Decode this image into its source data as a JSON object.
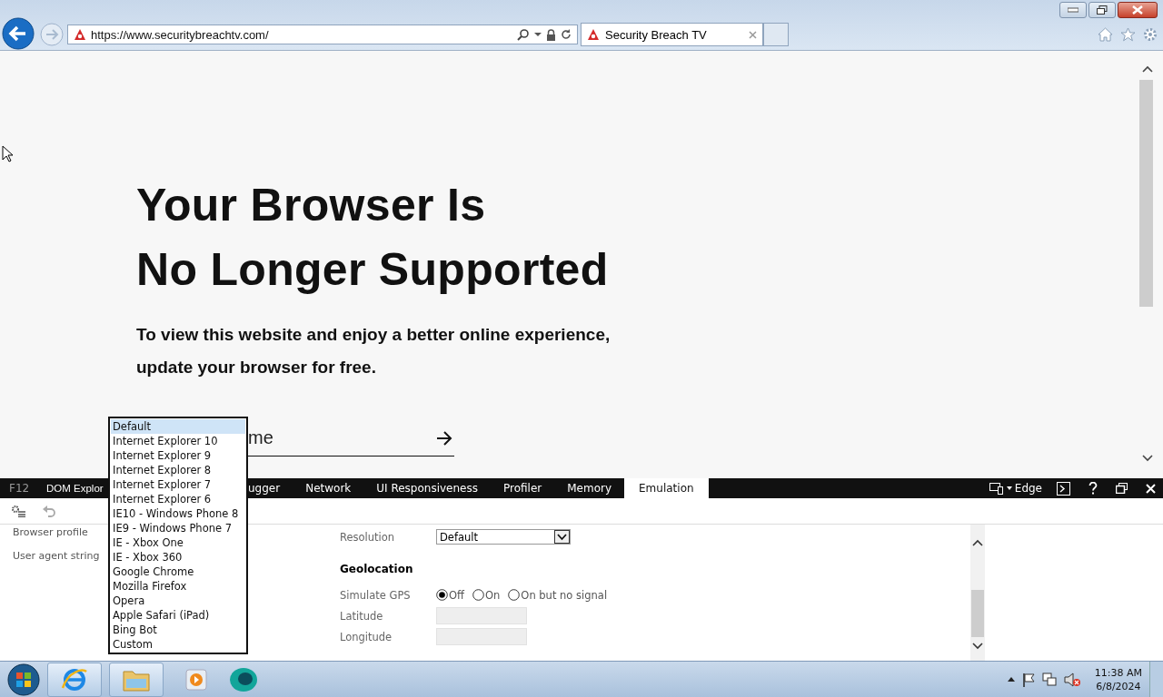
{
  "browser": {
    "back_enabled": true,
    "forward_enabled": false,
    "address": "https://www.securitybreachtv.com/",
    "tabs": [
      {
        "title": "Security Breach TV",
        "selected": true
      }
    ]
  },
  "page": {
    "heading_lines": [
      "Your Browser Is",
      "No Longer Supported"
    ],
    "subtext_lines": [
      "To view this website and enjoy a better online experience,",
      "update your browser for free."
    ],
    "input_visible_text": "me"
  },
  "devtools": {
    "f12_label": "F12",
    "tabs": [
      {
        "label": "DOM Explor",
        "selected": false
      },
      {
        "label": "ugger",
        "selected": false
      },
      {
        "label": "Network",
        "selected": false
      },
      {
        "label": "UI Responsiveness",
        "selected": false
      },
      {
        "label": "Profiler",
        "selected": false
      },
      {
        "label": "Memory",
        "selected": false
      },
      {
        "label": "Emulation",
        "selected": true
      }
    ],
    "mode": "Edge",
    "left_labels": [
      "Browser profile",
      "User agent string"
    ],
    "resolution": {
      "label": "Resolution",
      "value": "Default"
    },
    "geolocation": {
      "heading": "Geolocation",
      "gps_label": "Simulate GPS",
      "gps_options": [
        {
          "label": "Off",
          "selected": true
        },
        {
          "label": "On",
          "selected": false
        },
        {
          "label": "On but no signal",
          "selected": false
        }
      ],
      "fields": [
        {
          "label": "Latitude"
        },
        {
          "label": "Longitude"
        }
      ]
    },
    "dropdown": {
      "options": [
        {
          "label": "Default",
          "selected": true
        },
        {
          "label": "Internet Explorer 10",
          "selected": false
        },
        {
          "label": "Internet Explorer 9",
          "selected": false
        },
        {
          "label": "Internet Explorer 8",
          "selected": false
        },
        {
          "label": "Internet Explorer 7",
          "selected": false
        },
        {
          "label": "Internet Explorer 6",
          "selected": false
        },
        {
          "label": "IE10 - Windows Phone 8",
          "selected": false
        },
        {
          "label": "IE9 - Windows Phone 7",
          "selected": false
        },
        {
          "label": "IE - Xbox One",
          "selected": false
        },
        {
          "label": "IE - Xbox 360",
          "selected": false
        },
        {
          "label": "Google Chrome",
          "selected": false
        },
        {
          "label": "Mozilla Firefox",
          "selected": false
        },
        {
          "label": "Opera",
          "selected": false
        },
        {
          "label": "Apple Safari (iPad)",
          "selected": false
        },
        {
          "label": "Bing Bot",
          "selected": false
        },
        {
          "label": "Custom",
          "selected": false
        }
      ]
    }
  },
  "taskbar": {
    "time": "11:38 AM",
    "date": "6/8/2024"
  }
}
